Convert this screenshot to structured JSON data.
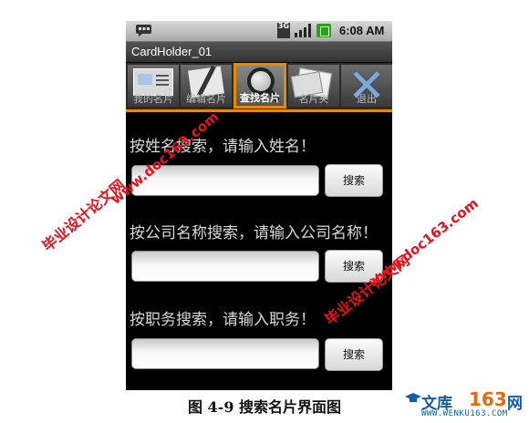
{
  "status_bar": {
    "network": "3G",
    "time": "6:08 AM"
  },
  "app": {
    "title": "CardHolder_01"
  },
  "tabs": [
    {
      "label": "我的名片",
      "icon": "card-icon",
      "selected": false
    },
    {
      "label": "编辑名片",
      "icon": "edit-pen-icon",
      "selected": false
    },
    {
      "label": "查找名片",
      "icon": "magnifier-icon",
      "selected": true
    },
    {
      "label": "名片夹",
      "icon": "card-stack-icon",
      "selected": false
    },
    {
      "label": "退出",
      "icon": "exit-x-icon",
      "selected": false
    }
  ],
  "search": {
    "by_name_label": "按姓名搜索，请输入姓名！",
    "by_company_label": "按公司名称搜索，请输入公司名称！",
    "by_title_label": "按职务搜索，请输入职务！",
    "button_label": "搜索",
    "name_value": "",
    "company_value": "",
    "title_value": ""
  },
  "watermarks": {
    "text1": "毕业设计论文网",
    "text2": "www.doc163.com",
    "text3": "毕业设计论文网",
    "text4": "www.doc163.com"
  },
  "caption": "图 4-9 搜索名片界面图",
  "logo": {
    "text": "文库",
    "number": "163",
    "suffix": "网",
    "url": "WWW.WENKU163.COM"
  },
  "colors": {
    "accent": "#e88a00",
    "watermark": "#e8101a",
    "background": "#000000"
  }
}
